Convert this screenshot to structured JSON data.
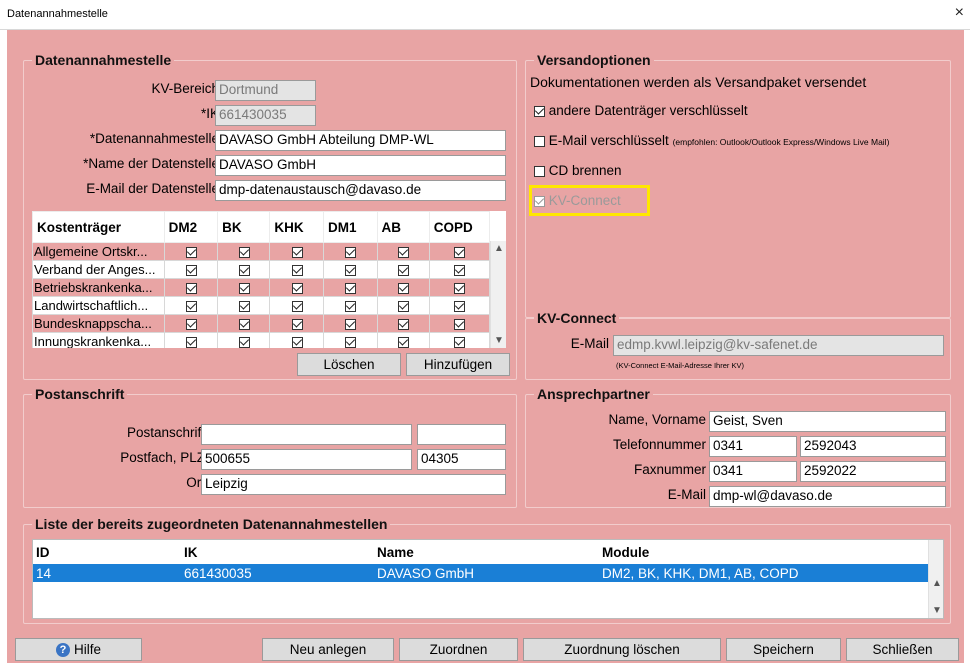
{
  "window": {
    "title": "Datenannahmestelle",
    "close": "×"
  },
  "dannahme": {
    "title": "Datenannahmestelle",
    "kv_label": "KV-Bereich",
    "kv_value": "Dortmund",
    "ik_label": "*IK",
    "ik_value": "661430035",
    "dst_label": "*Datenannahmestelle",
    "dst_value": "DAVASO GmbH Abteilung DMP-WL",
    "name_label": "*Name der Datenstelle",
    "name_value": "DAVASO GmbH",
    "email_label": "E-Mail der Datenstelle",
    "email_value": "dmp-datenaustausch@davaso.de"
  },
  "kostentraeger": {
    "headers": [
      "Kostenträger",
      "DM2",
      "BK",
      "KHK",
      "DM1",
      "AB",
      "COPD"
    ],
    "rows": [
      "Allgemeine Ortskr...",
      "Verband der Anges...",
      "Betriebskrankenka...",
      "Landwirtschaftlich...",
      "Bundesknappscha...",
      "Innungskrankenka..."
    ],
    "delete_label": "Löschen",
    "add_label": "Hinzufügen"
  },
  "versand": {
    "title": "Versandoptionen",
    "desc": "Dokumentationen werden als Versandpaket versendet",
    "opt1": "andere Datenträger verschlüsselt",
    "opt2": "E-Mail verschlüsselt",
    "opt2_hint": "(empfohlen: Outlook/Outlook Express/Windows Live Mail)",
    "opt3": "CD brennen",
    "opt4": "KV-Connect",
    "highlight_color": "#ffe600"
  },
  "kvconnect": {
    "title": "KV-Connect",
    "email_label": "E-Mail",
    "email_value": "edmp.kvwl.leipzig@kv-safenet.de",
    "hint": "(KV-Connect E-Mail-Adresse Ihrer KV)"
  },
  "post": {
    "title": "Postanschrift",
    "pa_label": "Postanschrift",
    "pf_label": "Postfach, PLZ",
    "pf_value": "500655",
    "plz_value": "04305",
    "ort_label": "Ort",
    "ort_value": "Leipzig"
  },
  "ansprech": {
    "title": "Ansprechpartner",
    "name_label": "Name, Vorname",
    "name_value": "Geist, Sven",
    "tel_label": "Telefonnummer",
    "tel_pre": "0341",
    "tel_num": "2592043",
    "fax_label": "Faxnummer",
    "fax_pre": "0341",
    "fax_num": "2592022",
    "email_label": "E-Mail",
    "email_value": "dmp-wl@davaso.de"
  },
  "liste": {
    "title": "Liste der bereits zugeordneten Datenannahmestellen",
    "headers": {
      "id": "ID",
      "ik": "IK",
      "name": "Name",
      "module": "Module"
    },
    "row": {
      "id": "14",
      "ik": "661430035",
      "name": "DAVASO GmbH",
      "module": "DM2, BK, KHK, DM1, AB, COPD"
    }
  },
  "footer": {
    "help": "Hilfe",
    "new": "Neu anlegen",
    "assign": "Zuordnen",
    "unassign": "Zuordnung löschen",
    "save": "Speichern",
    "close": "Schließen"
  },
  "colors": {
    "background": "#e8a4a4",
    "selection": "#1a7fd6"
  }
}
